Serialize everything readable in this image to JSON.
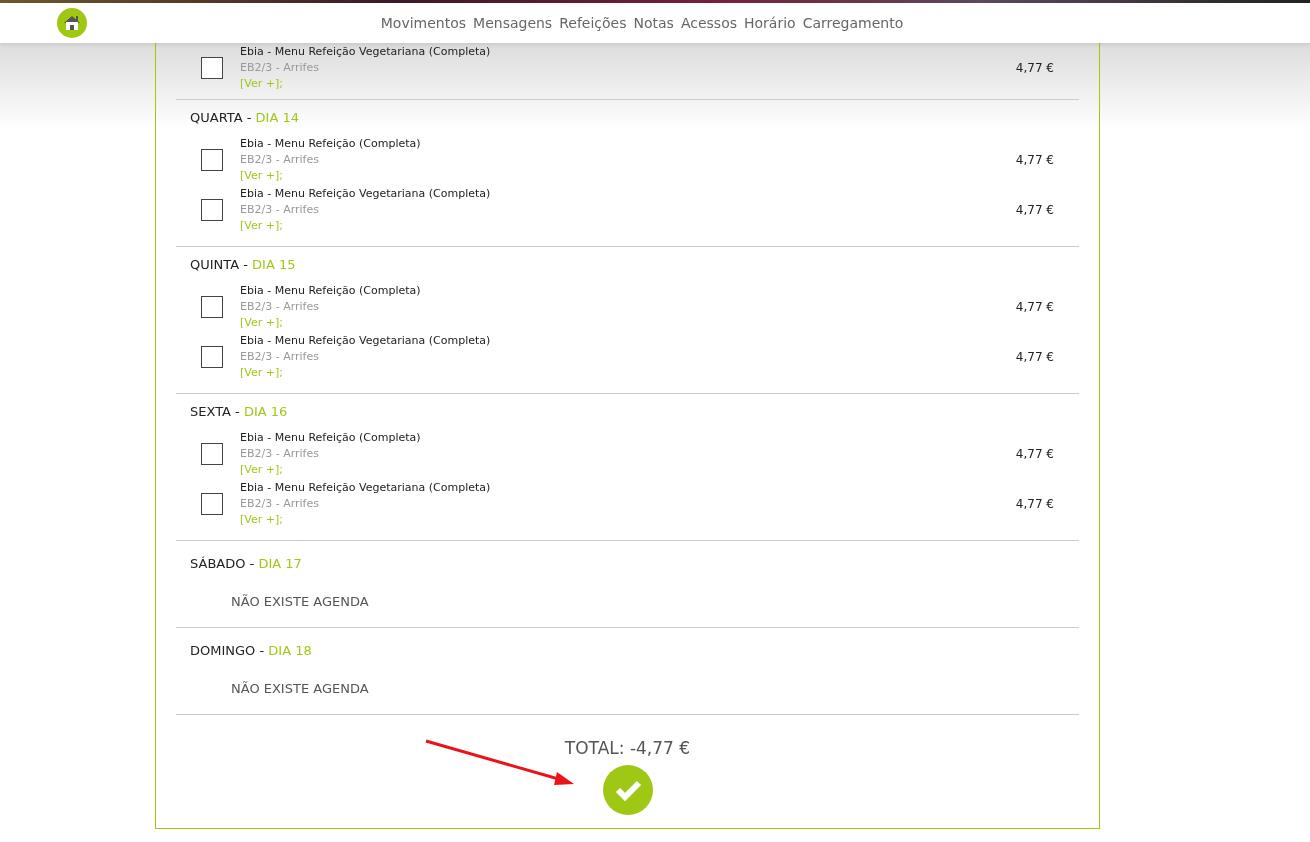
{
  "header": {
    "nav": [
      {
        "label": "Movimentos"
      },
      {
        "label": "Mensagens"
      },
      {
        "label": "Refeições"
      },
      {
        "label": "Notas"
      },
      {
        "label": "Acessos"
      },
      {
        "label": "Horário"
      },
      {
        "label": "Carregamento"
      }
    ]
  },
  "days": [
    {
      "meals": [
        {
          "title": "Ebia - Menu Refeição Vegetariana (Completa)",
          "place": "EB2/3 - Arrifes",
          "more": "[Ver +];",
          "price": "4,77 €",
          "checked": false
        }
      ]
    },
    {
      "weekday": "QUARTA -",
      "day": "DIA 14",
      "meals": [
        {
          "title": "Ebia - Menu Refeição (Completa)",
          "place": "EB2/3 - Arrifes",
          "more": "[Ver +];",
          "price": "4,77 €",
          "checked": false
        },
        {
          "title": "Ebia - Menu Refeição Vegetariana (Completa)",
          "place": "EB2/3 - Arrifes",
          "more": "[Ver +];",
          "price": "4,77 €",
          "checked": false
        }
      ]
    },
    {
      "weekday": "QUINTA -",
      "day": "DIA 15",
      "meals": [
        {
          "title": "Ebia - Menu Refeição (Completa)",
          "place": "EB2/3 - Arrifes",
          "more": "[Ver +];",
          "price": "4,77 €",
          "checked": false
        },
        {
          "title": "Ebia - Menu Refeição Vegetariana (Completa)",
          "place": "EB2/3 - Arrifes",
          "more": "[Ver +];",
          "price": "4,77 €",
          "checked": false
        }
      ]
    },
    {
      "weekday": "SEXTA -",
      "day": "DIA 16",
      "meals": [
        {
          "title": "Ebia - Menu Refeição (Completa)",
          "place": "EB2/3 - Arrifes",
          "more": "[Ver +];",
          "price": "4,77 €",
          "checked": false
        },
        {
          "title": "Ebia - Menu Refeição Vegetariana (Completa)",
          "place": "EB2/3 - Arrifes",
          "more": "[Ver +];",
          "price": "4,77 €",
          "checked": false
        }
      ]
    },
    {
      "weekday": "SÁBADO -",
      "day": "DIA 17",
      "empty_text": "NÃO EXISTE AGENDA"
    },
    {
      "weekday": "DOMINGO -",
      "day": "DIA 18",
      "empty_text": "NÃO EXISTE AGENDA"
    }
  ],
  "total": "TOTAL: -4,77 €"
}
